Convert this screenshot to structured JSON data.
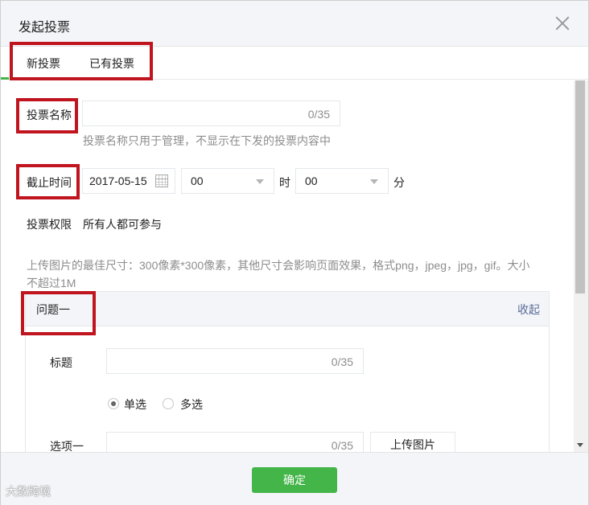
{
  "dialog": {
    "title": "发起投票"
  },
  "tabs": [
    {
      "label": "新投票"
    },
    {
      "label": "已有投票"
    }
  ],
  "form": {
    "vote_name": {
      "label": "投票名称",
      "value": "",
      "counter": "0/35",
      "hint": "投票名称只用于管理，不显示在下发的投票内容中"
    },
    "deadline": {
      "label": "截止时间",
      "date": "2017-05-15",
      "hour": "00",
      "hour_unit": "时",
      "minute": "00",
      "minute_unit": "分"
    },
    "permission": {
      "label": "投票权限",
      "value": "所有人都可参与"
    },
    "image_hint_line1": "上传图片的最佳尺寸：300像素*300像素，其他尺寸会影响页面效果，格式png，jpeg，jpg，gif。大小",
    "image_hint_line2": "不超过1M"
  },
  "question": {
    "title": "问题一",
    "collapse_label": "收起",
    "title_field": {
      "label": "标题",
      "value": "",
      "counter": "0/35"
    },
    "type_options": [
      {
        "label": "单选",
        "checked": true
      },
      {
        "label": "多选",
        "checked": false
      }
    ],
    "option1": {
      "label": "选项一",
      "value": "",
      "counter": "0/35",
      "upload_label": "上传图片"
    }
  },
  "footer": {
    "confirm_label": "确定"
  },
  "watermark": "大数跨境",
  "colors": {
    "accent_green": "#44b549",
    "link_blue": "#576b95",
    "annotation_red": "#c0141f"
  }
}
